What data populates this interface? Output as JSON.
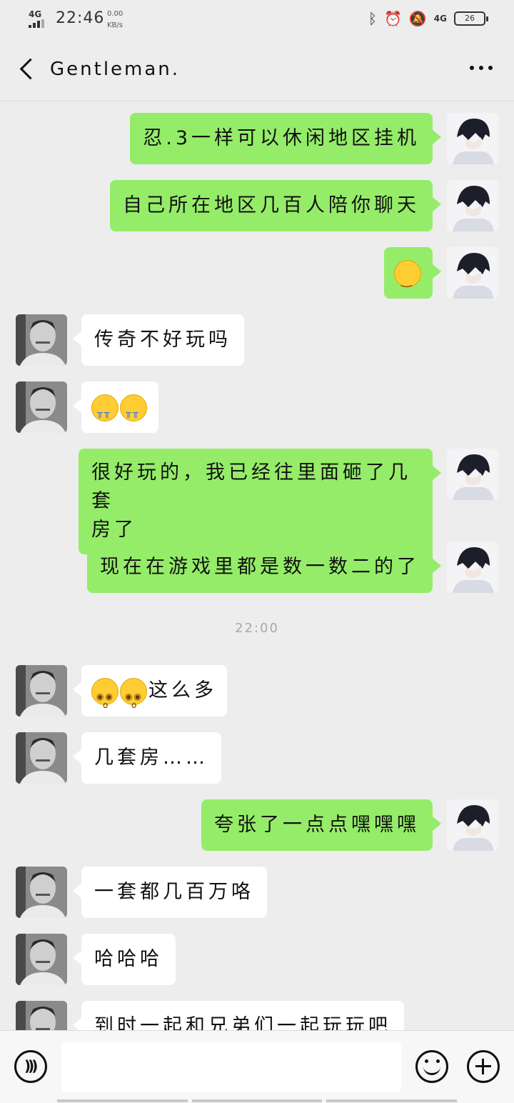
{
  "status_bar": {
    "network_type": "4G",
    "time": "22:46",
    "speed_value": "0.00",
    "speed_unit": "KB/s",
    "right_network": "4G",
    "battery": "26"
  },
  "header": {
    "title": "Gentleman."
  },
  "messages": [
    {
      "side": "me",
      "text": "忍.3一样可以休闲地区挂机"
    },
    {
      "side": "me",
      "text": "自己所在地区几百人陪你聊天"
    },
    {
      "side": "me",
      "emojis": [
        "smug-face-emoji"
      ]
    },
    {
      "side": "them",
      "text": "传奇不好玩吗"
    },
    {
      "side": "them",
      "emojis": [
        "crying-face-emoji",
        "crying-face-emoji"
      ]
    },
    {
      "side": "me",
      "text_line1": "很好玩的，我已经往里面砸了几套",
      "text_line2": "房了"
    },
    {
      "side": "me",
      "text": "现在在游戏里都是数一数二的了"
    },
    {
      "timestamp": "22:00"
    },
    {
      "side": "them",
      "emojis": [
        "astonished-face-emoji",
        "astonished-face-emoji"
      ],
      "text": "这么多"
    },
    {
      "side": "them",
      "text": "几套房……"
    },
    {
      "side": "me",
      "text": "夸张了一点点嘿嘿嘿"
    },
    {
      "side": "them",
      "text": "一套都几百万咯"
    },
    {
      "side": "them",
      "text": "哈哈哈"
    },
    {
      "side": "them",
      "text": "到时一起和兄弟们一起玩玩吧"
    }
  ],
  "input_bar": {
    "placeholder": ""
  },
  "colors": {
    "background": "#ededed",
    "my_bubble": "#95ec69",
    "their_bubble": "#ffffff",
    "timestamp_text": "#a9a9a9"
  }
}
